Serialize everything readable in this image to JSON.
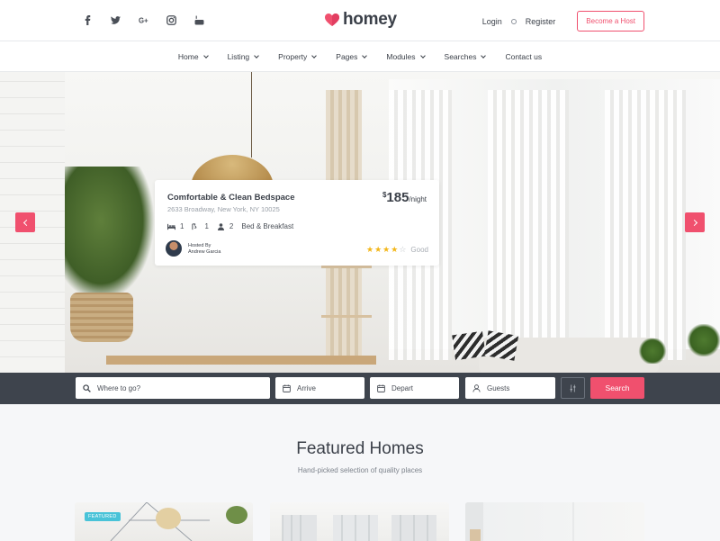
{
  "header": {
    "social_icons": [
      "facebook-icon",
      "twitter-icon",
      "google-plus-icon",
      "instagram-icon",
      "youtube-icon"
    ],
    "logo_text": "homey",
    "login_label": "Login",
    "register_label": "Register",
    "host_button_label": "Become a Host"
  },
  "nav": {
    "items": [
      {
        "label": "Home",
        "has_dropdown": true
      },
      {
        "label": "Listing",
        "has_dropdown": true
      },
      {
        "label": "Property",
        "has_dropdown": true
      },
      {
        "label": "Pages",
        "has_dropdown": true
      },
      {
        "label": "Modules",
        "has_dropdown": true
      },
      {
        "label": "Searches",
        "has_dropdown": true
      },
      {
        "label": "Contact us",
        "has_dropdown": false
      }
    ]
  },
  "hero_card": {
    "title": "Comfortable & Clean Bedspace",
    "address": "2633 Broadway, New York, NY 10025",
    "price_currency": "$",
    "price": "185",
    "price_period": "/night",
    "beds": "1",
    "baths": "1",
    "guests": "2",
    "type": "Bed & Breakfast",
    "hosted_by_label": "Hosted By",
    "host_name": "Andrew Garcia",
    "rating_stars": 4,
    "rating_max": 5,
    "rating_text": "Good"
  },
  "search": {
    "where_placeholder": "Where to go?",
    "arrive_placeholder": "Arrive",
    "depart_placeholder": "Depart",
    "guests_placeholder": "Guests",
    "search_label": "Search"
  },
  "featured": {
    "title": "Featured Homes",
    "subtitle": "Hand-picked selection of quality places",
    "badge": "FEATURED"
  },
  "colors": {
    "accent": "#f0506e",
    "search_bar_bg": "#3e444d",
    "star": "#f3b618",
    "badge": "#49c3d8"
  }
}
